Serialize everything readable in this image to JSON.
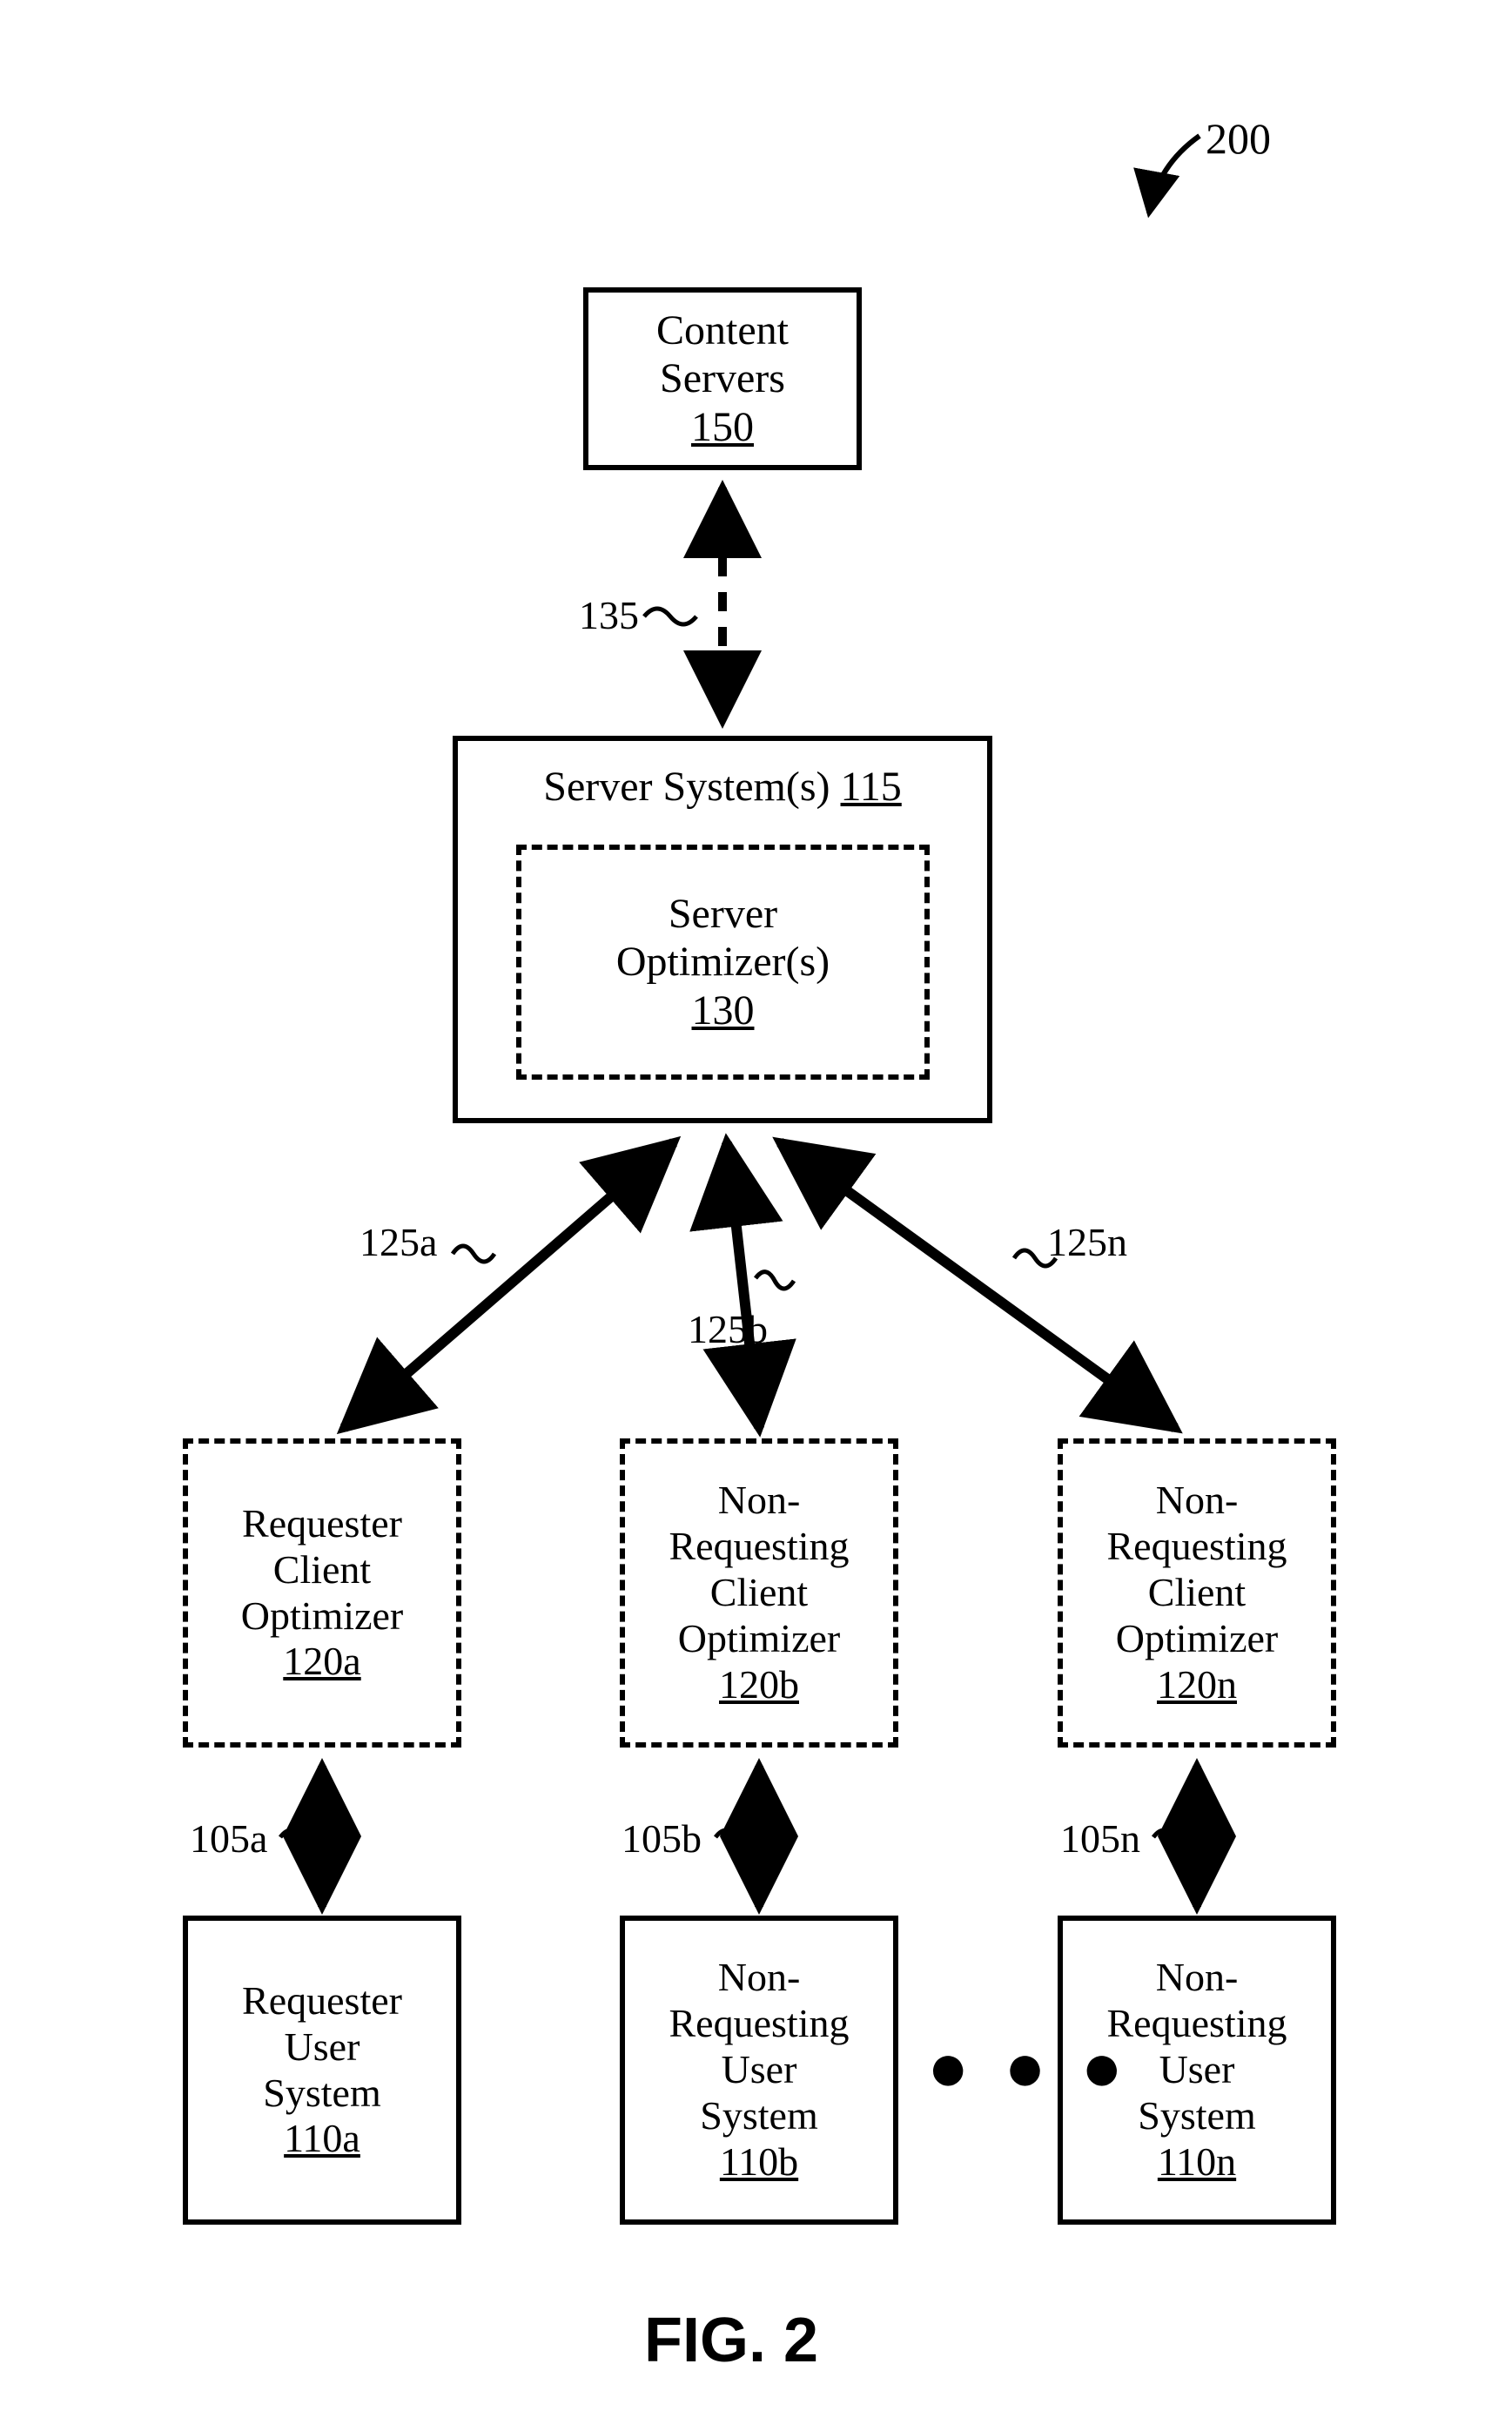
{
  "figure": {
    "number_ref": "200",
    "caption": "FIG. 2"
  },
  "boxes": {
    "content_servers": {
      "line1": "Content",
      "line2": "Servers",
      "ref": "150"
    },
    "server_systems": {
      "title_a": "Server System(s)",
      "title_ref": "115"
    },
    "server_optimizer": {
      "line1": "Server",
      "line2": "Optimizer(s)",
      "ref": "130"
    },
    "req_opt": {
      "l1": "Requester",
      "l2": "Client",
      "l3": "Optimizer",
      "ref": "120a"
    },
    "nr_opt_b": {
      "l1": "Non-",
      "l2": "Requesting",
      "l3": "Client",
      "l4": "Optimizer",
      "ref": "120b"
    },
    "nr_opt_n": {
      "l1": "Non-",
      "l2": "Requesting",
      "l3": "Client",
      "l4": "Optimizer",
      "ref": "120n"
    },
    "req_user": {
      "l1": "Requester",
      "l2": "User",
      "l3": "System",
      "ref": "110a"
    },
    "nr_user_b": {
      "l1": "Non-",
      "l2": "Requesting",
      "l3": "User",
      "l4": "System",
      "ref": "110b"
    },
    "nr_user_n": {
      "l1": "Non-",
      "l2": "Requesting",
      "l3": "User",
      "l4": "System",
      "ref": "110n"
    }
  },
  "labels": {
    "link_135": "135",
    "link_125a": "125a",
    "link_125b": "125b",
    "link_125n": "125n",
    "link_105a": "105a",
    "link_105b": "105b",
    "link_105n": "105n"
  },
  "ellipsis": "● ● ●"
}
